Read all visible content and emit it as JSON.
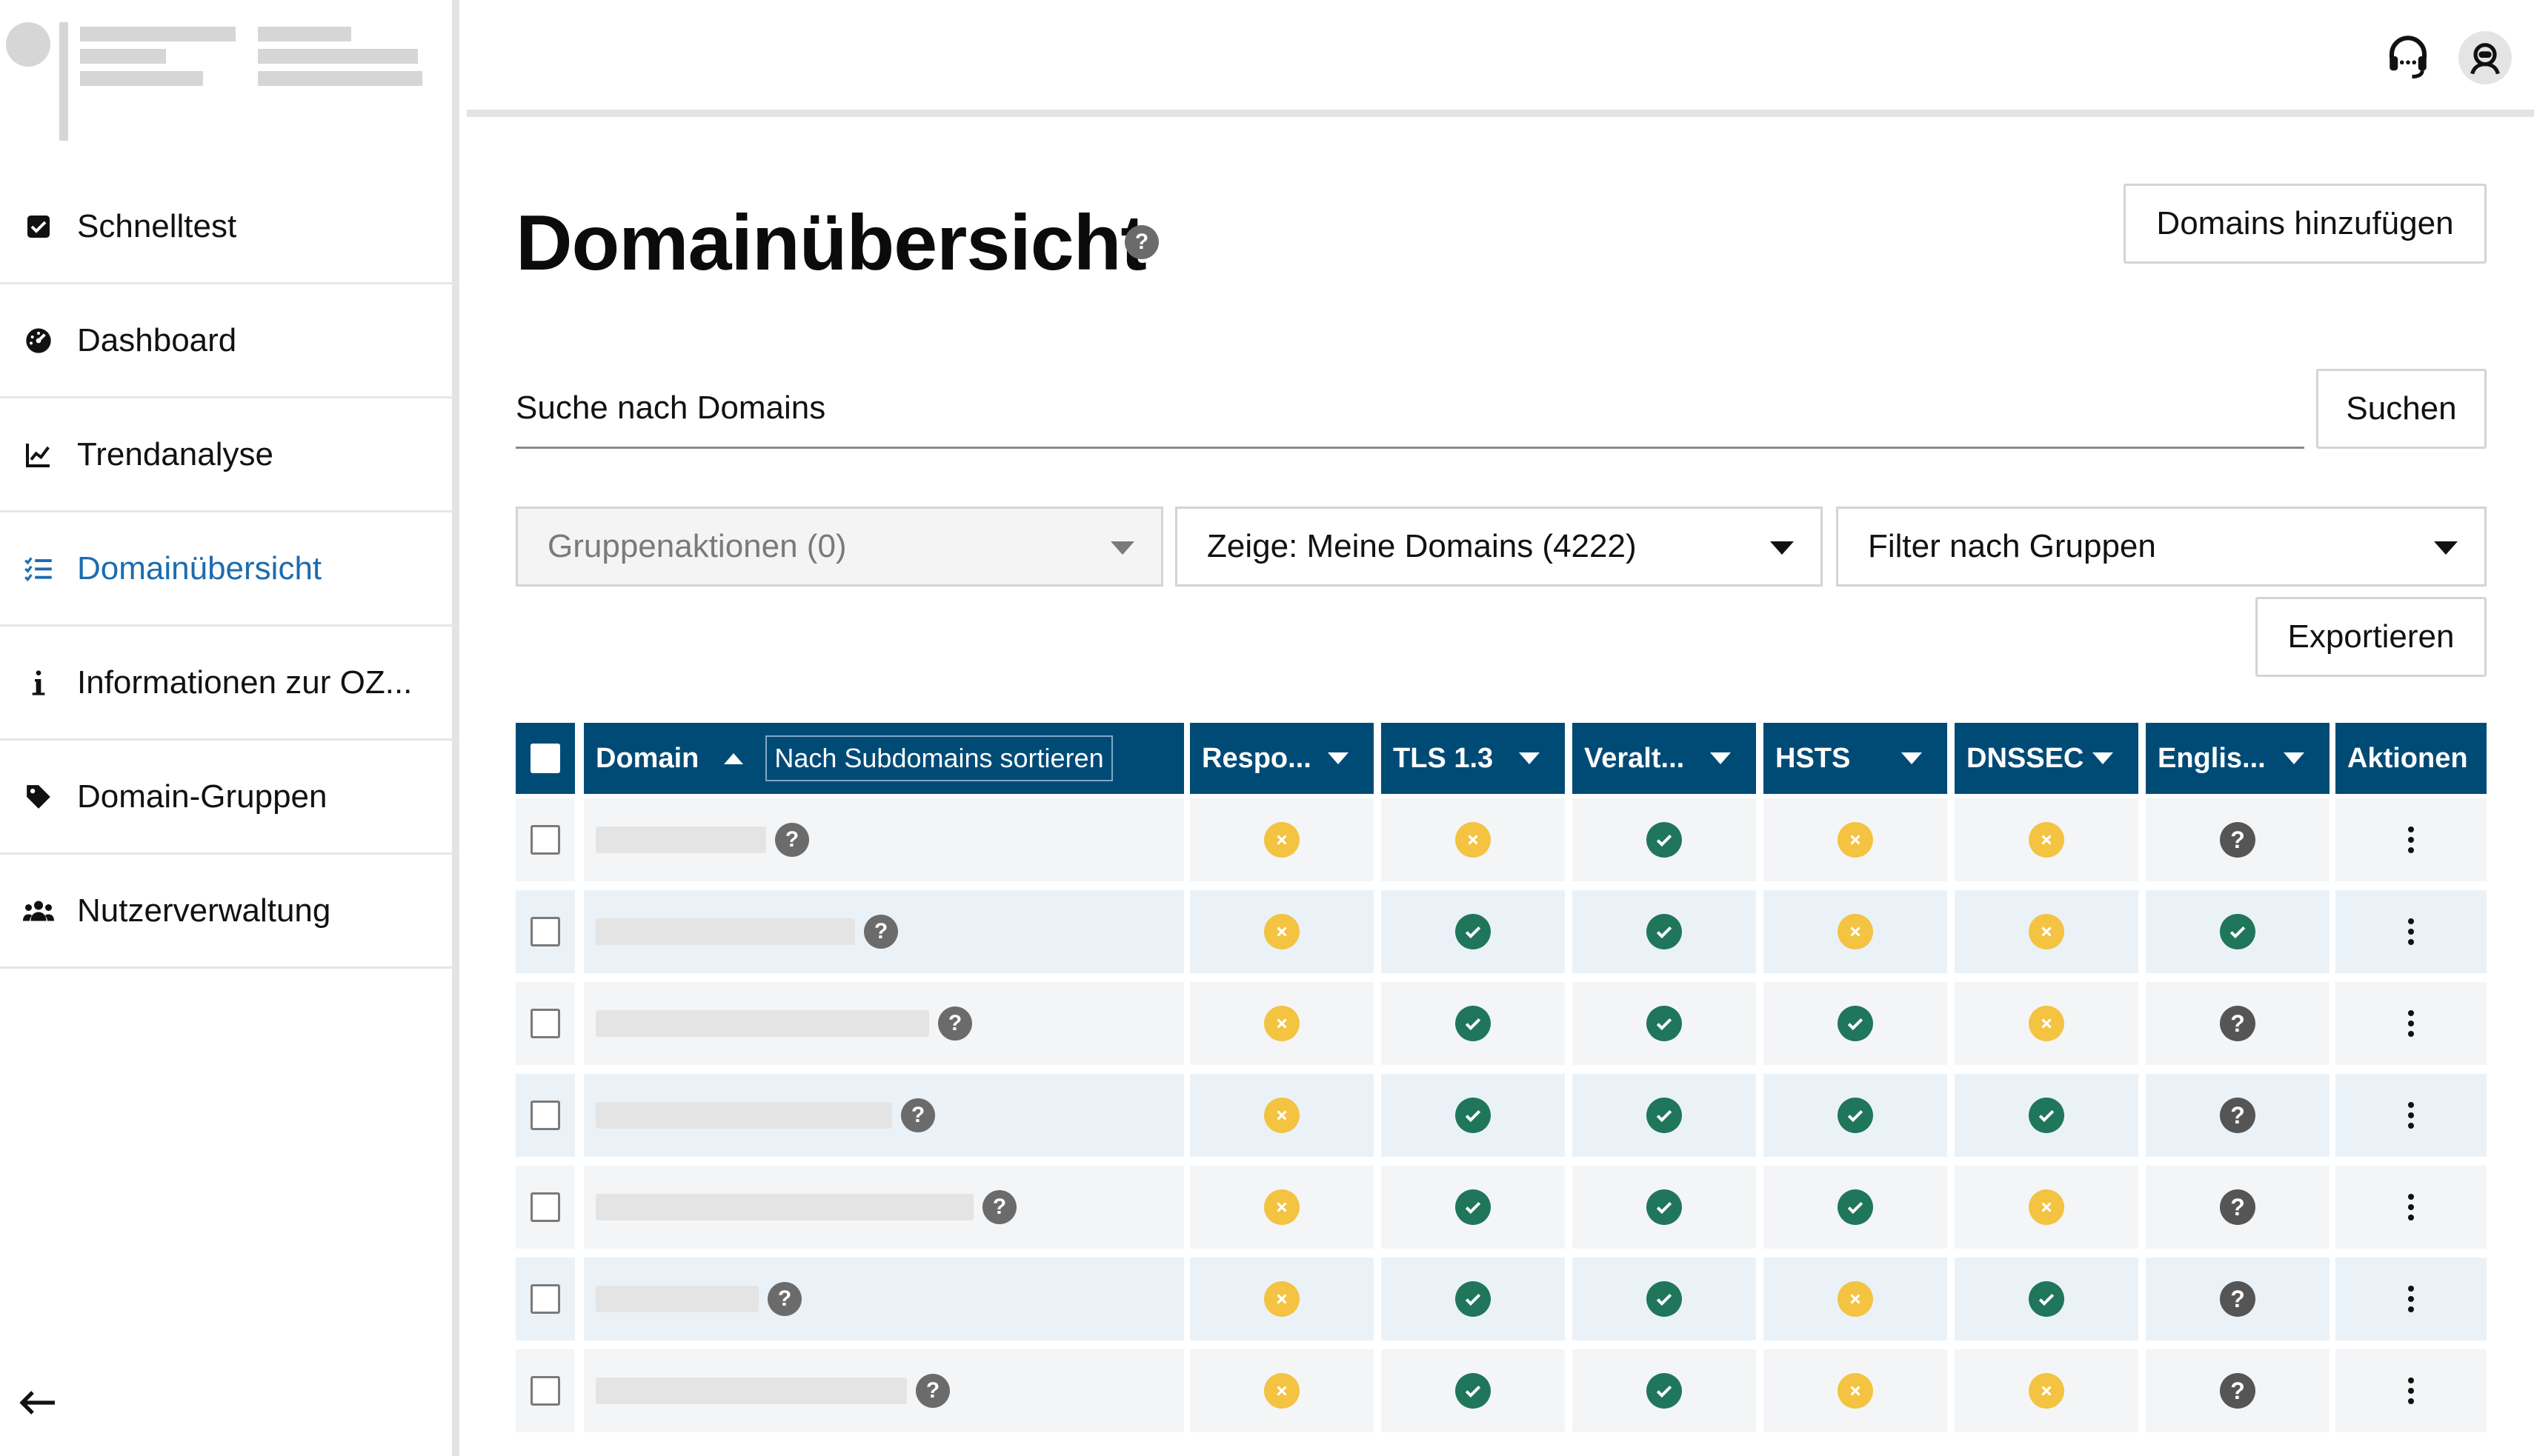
{
  "sidebar": {
    "items": [
      {
        "label": "Schnelltest",
        "icon": "checkbox-icon",
        "active": false
      },
      {
        "label": "Dashboard",
        "icon": "gauge-icon",
        "active": false
      },
      {
        "label": "Trendanalyse",
        "icon": "line-chart-icon",
        "active": false
      },
      {
        "label": "Domainübersicht",
        "icon": "list-check-icon",
        "active": true
      },
      {
        "label": "Informationen zur OZ...",
        "icon": "info-icon",
        "active": false
      },
      {
        "label": "Domain-Gruppen",
        "icon": "tag-icon",
        "active": false
      },
      {
        "label": "Nutzerverwaltung",
        "icon": "users-icon",
        "active": false
      }
    ],
    "collapse_icon": "arrow-left-icon"
  },
  "topbar": {
    "support_icon": "headset-icon",
    "user_icon": "user-avatar-icon"
  },
  "main": {
    "title": "Domainübersicht",
    "title_help": "?",
    "add_domains_label": "Domains hinzufügen",
    "search": {
      "placeholder": "Suche nach Domains",
      "button_label": "Suchen"
    },
    "group_actions_label": "Gruppenaktionen (0)",
    "show_filter_label": "Zeige: Meine Domains (4222)",
    "group_filter_label": "Filter nach Gruppen",
    "export_label": "Exportieren"
  },
  "table": {
    "columns": {
      "domain": "Domain",
      "subdomain_sort": "Nach Subdomains sortieren",
      "responsible": "Respo...",
      "tls13": "TLS 1.3",
      "deprecated": "Veralt...",
      "hsts": "HSTS",
      "dnssec": "DNSSEC",
      "english": "Englis...",
      "actions": "Aktionen"
    },
    "rows": [
      {
        "statuses": [
          "warn",
          "warn",
          "ok",
          "warn",
          "warn",
          "unk"
        ]
      },
      {
        "statuses": [
          "warn",
          "ok",
          "ok",
          "warn",
          "warn",
          "ok"
        ]
      },
      {
        "statuses": [
          "warn",
          "ok",
          "ok",
          "ok",
          "warn",
          "unk"
        ]
      },
      {
        "statuses": [
          "warn",
          "ok",
          "ok",
          "ok",
          "ok",
          "unk"
        ]
      },
      {
        "statuses": [
          "warn",
          "ok",
          "ok",
          "ok",
          "warn",
          "unk"
        ]
      },
      {
        "statuses": [
          "warn",
          "ok",
          "ok",
          "warn",
          "ok",
          "unk"
        ]
      },
      {
        "statuses": [
          "warn",
          "ok",
          "ok",
          "warn",
          "warn",
          "unk"
        ]
      }
    ],
    "unknown_glyph": "?"
  },
  "colors": {
    "header_blue": "#004b76",
    "active_link": "#1c6cb0",
    "status_ok": "#20765a",
    "status_warn": "#f3c341",
    "status_unknown": "#555555"
  }
}
